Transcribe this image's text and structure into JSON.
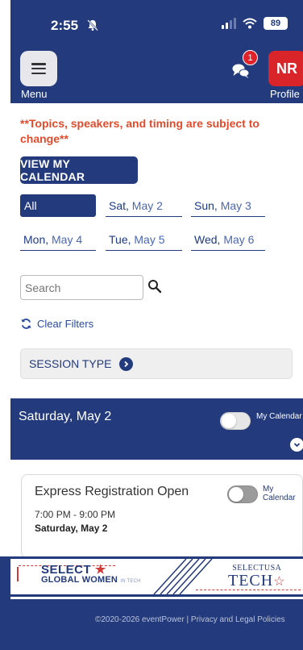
{
  "status_bar": {
    "time": "2:55",
    "battery": "89"
  },
  "header": {
    "menu_label": "Menu",
    "notification_count": "1",
    "profile_initials": "NR",
    "profile_label": "Profile"
  },
  "notice": "**Topics, speakers, and timing are subject to change**",
  "calendar_button": "VIEW MY CALENDAR",
  "day_tabs": [
    {
      "label": "All",
      "day": "",
      "date": ""
    },
    {
      "day": "Sat,",
      "date": " May 2"
    },
    {
      "day": "Sun,",
      "date": " May 3"
    },
    {
      "day": "Mon,",
      "date": " May 4"
    },
    {
      "day": "Tue,",
      "date": " May 5"
    },
    {
      "day": "Wed,",
      "date": " May 6"
    }
  ],
  "search": {
    "placeholder": "Search"
  },
  "clear_filters": "Clear Filters",
  "session_type": "SESSION TYPE",
  "day_section": {
    "title": "Saturday, May 2",
    "my_calendar_label": "My Calendar"
  },
  "session": {
    "title": "Express Registration Open",
    "time": "7:00 PM - 9:00 PM",
    "date": "Saturday, May 2",
    "my_calendar_label": "My Calendar"
  },
  "banner": {
    "left_line1": "SELECT",
    "left_line2": "GLOBAL WOMEN",
    "left_side": "IN TECH",
    "right_line1": "SELECTUSA",
    "right_line2": "TECH"
  },
  "footer": "©2020-2026 eventPower | Privacy and Legal Policies",
  "colors": {
    "brand_navy": "#233a7c",
    "alert_red": "#e14b2c",
    "profile_red": "#d9252a"
  }
}
